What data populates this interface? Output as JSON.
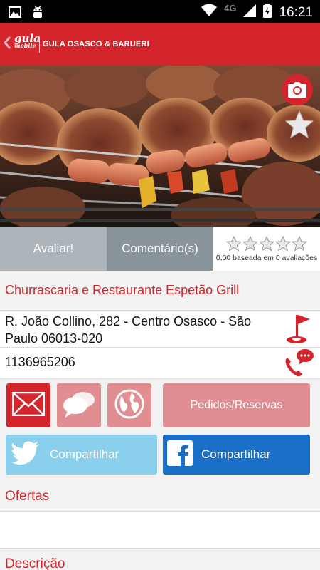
{
  "status_bar": {
    "time": "16:21",
    "network": "4G",
    "icons": [
      "image-icon",
      "android-icon",
      "wifi-icon",
      "signal-icon",
      "battery-charging-icon"
    ]
  },
  "app_bar": {
    "logo_line1": "gula",
    "logo_line2": "mobile",
    "title": "GULA OSASCO & BARUERI",
    "accent_color": "#d3252b"
  },
  "actions": {
    "avaliar": "Avaliar!",
    "comentarios": "Comentário(s)",
    "rating_text": "0,00 baseada em 0 avaliações",
    "rating_value": 0,
    "rating_max": 5
  },
  "restaurant": {
    "name": "Churrascaria e Restaurante Espetão Grill",
    "address": "R. João Collino, 282 - Centro Osasco - São Paulo 06013-020",
    "phone": "1136965206"
  },
  "buttons": {
    "pedidos": "Pedidos/Reservas",
    "twitter_share": "Compartilhar",
    "facebook_share": "Compartilhar"
  },
  "sections": {
    "ofertas": "Ofertas",
    "descricao": "Descrição"
  }
}
